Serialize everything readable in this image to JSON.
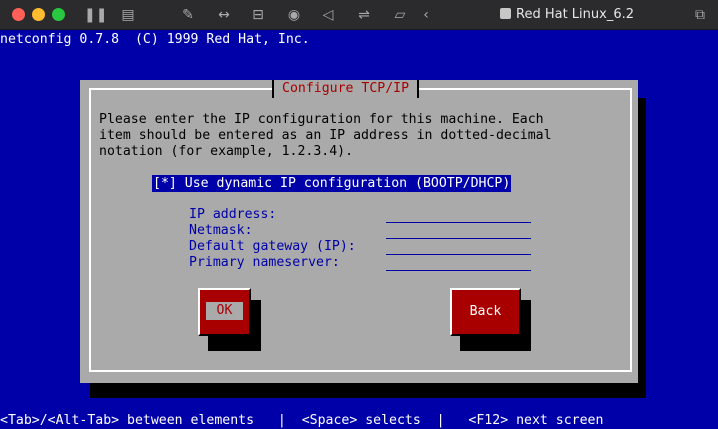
{
  "window": {
    "title": "Red Hat Linux_6.2",
    "toolbar_icons": [
      "sidebar-icon",
      "vm-settings-icon",
      "wrench-icon",
      "code-icon",
      "drive-icon",
      "camera-icon",
      "volume-icon",
      "usb-icon",
      "folder-icon",
      "back-icon",
      "snapshot-icon"
    ]
  },
  "terminal": {
    "header": "netconfig 0.7.8  (C) 1999 Red Hat, Inc."
  },
  "dialog": {
    "title": "Configure TCP/IP",
    "description": [
      "Please enter the IP configuration for this machine. Each",
      "item should be entered as an IP address in dotted-decimal",
      "notation (for example, 1.2.3.4)."
    ],
    "checkbox": {
      "mark": "[*]",
      "label": "Use dynamic IP configuration (BOOTP/DHCP)",
      "checked": true
    },
    "fields": [
      {
        "label": "IP address:",
        "value": ""
      },
      {
        "label": "Netmask:",
        "value": ""
      },
      {
        "label": "Default gateway (IP):",
        "value": ""
      },
      {
        "label": "Primary nameserver:",
        "value": ""
      }
    ],
    "buttons": {
      "ok": "OK",
      "back": "Back"
    }
  },
  "statusbar": {
    "text": "<Tab>/<Alt-Tab> between elements   |  <Space> selects  |   <F12> next screen"
  },
  "colors": {
    "background": "#0000a8",
    "dialog": "#aaaaaa",
    "accent_red": "#a80000",
    "text_white": "#ffffff"
  }
}
